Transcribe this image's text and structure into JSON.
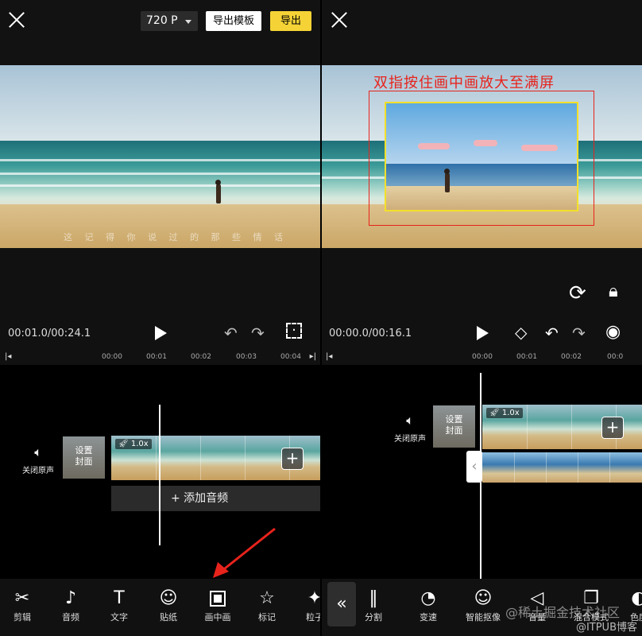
{
  "left": {
    "topbar": {
      "resolution": "720 P",
      "template_label": "导出模板",
      "export_label": "导出"
    },
    "preview": {
      "subtitle": "这 记 得 你 说 过 的 那 些 情 话"
    },
    "controls": {
      "timecode": "00:01.0/00:24.1"
    },
    "ruler": {
      "ticks": [
        "00:00",
        "00:01",
        "00:02",
        "00:03",
        "00:04"
      ]
    },
    "tracks": {
      "mute_label": "关闭原声",
      "cover_label_1": "设置",
      "cover_label_2": "封面",
      "speed": "1.0x",
      "add_audio": "+ 添加音频"
    },
    "toolbar": [
      {
        "label": "剪辑",
        "icon": "scissors-icon",
        "glyph": "✂"
      },
      {
        "label": "音频",
        "icon": "music-note-icon",
        "glyph": "♪"
      },
      {
        "label": "文字",
        "icon": "text-icon",
        "glyph": "T"
      },
      {
        "label": "贴纸",
        "icon": "sticker-icon",
        "glyph": "☺"
      },
      {
        "label": "画中画",
        "icon": "picture-in-picture-icon",
        "glyph": ""
      },
      {
        "label": "标记",
        "icon": "bookmark-icon",
        "glyph": "☆"
      },
      {
        "label": "粒子",
        "icon": "particle-icon",
        "glyph": "✦"
      }
    ],
    "annotation_color": "#e8231c"
  },
  "right": {
    "preview": {
      "annotation": "双指按住画中画放大至满屏"
    },
    "controls": {
      "timecode": "00:00.0/00:16.1"
    },
    "ruler": {
      "ticks": [
        "00:00",
        "00:01",
        "00:02",
        "00:0"
      ]
    },
    "tracks": {
      "mute_label": "关闭原声",
      "cover_label_1": "设置",
      "cover_label_2": "封面",
      "speed": "1.0x"
    },
    "toolbar": [
      {
        "label": "分割",
        "icon": "split-icon",
        "glyph": "‖"
      },
      {
        "label": "变速",
        "icon": "speed-gauge-icon",
        "glyph": "◔"
      },
      {
        "label": "智能抠像",
        "icon": "smart-cutout-icon",
        "glyph": "☺"
      },
      {
        "label": "音量",
        "icon": "volume-icon",
        "glyph": "◁"
      },
      {
        "label": "混合模式",
        "icon": "blend-mode-icon",
        "glyph": "❐"
      },
      {
        "label": "色度",
        "icon": "chroma-icon",
        "glyph": "◐"
      }
    ]
  },
  "watermark": {
    "line1": "@稀土掘金技术社区",
    "line2": "@ITPUB博客"
  },
  "colors": {
    "export_yellow": "#f5d336",
    "frame_red": "#e8231c",
    "pip_yellow": "#f3e02a"
  }
}
